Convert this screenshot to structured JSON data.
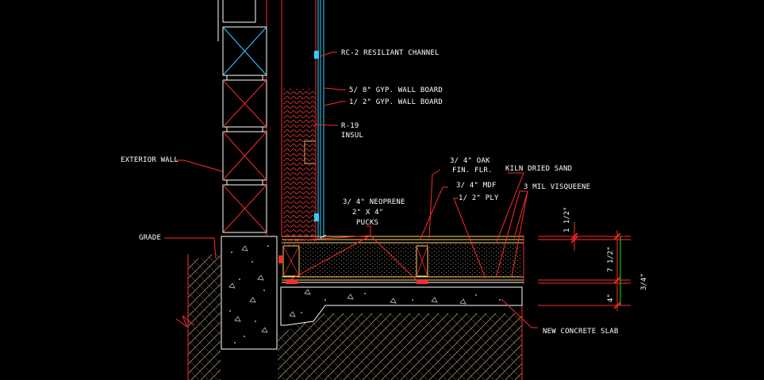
{
  "labels": {
    "rc2": "RC-2 RESILIANT CHANNEL",
    "gyp58": "5/ 8\" GYP. WALL BOARD",
    "gyp12": "1/ 2\" GYP. WALL BOARD",
    "r19a": "R-19",
    "r19b": "INSUL",
    "exterior_wall": "EXTERIOR WALL",
    "grade": "GRADE",
    "oak_a": "3/ 4\" OAK",
    "oak_b": "FIN. FLR.",
    "kiln": "KILN DRIED SAND",
    "mdf": "3/ 4\" MDF",
    "ply": "1/ 2\" PLY",
    "visqueen": "3 MIL VISQUEENE",
    "neo_a": "3/ 4\" NEOPRENE",
    "neo_b": "2\" X 4\"",
    "neo_c": "PUCKS",
    "slab": "NEW CONCRETE SLAB"
  },
  "dimensions": {
    "d1": "1 1/2\"",
    "d2": "7 1/2\"",
    "d3": "4\"",
    "d4": "3/4\""
  },
  "colors": {
    "background": "#000000",
    "outline": "#ff2a2a",
    "wall_block": "#ffffff",
    "block_cross": "#ff2a2a",
    "top_cross": "#2fd0ff",
    "channel": "#2fd0ff",
    "floor_layers": "#ffd46a",
    "hatch": "#b9a777",
    "text": "#ffffff",
    "dimension_green": "#19e019"
  }
}
